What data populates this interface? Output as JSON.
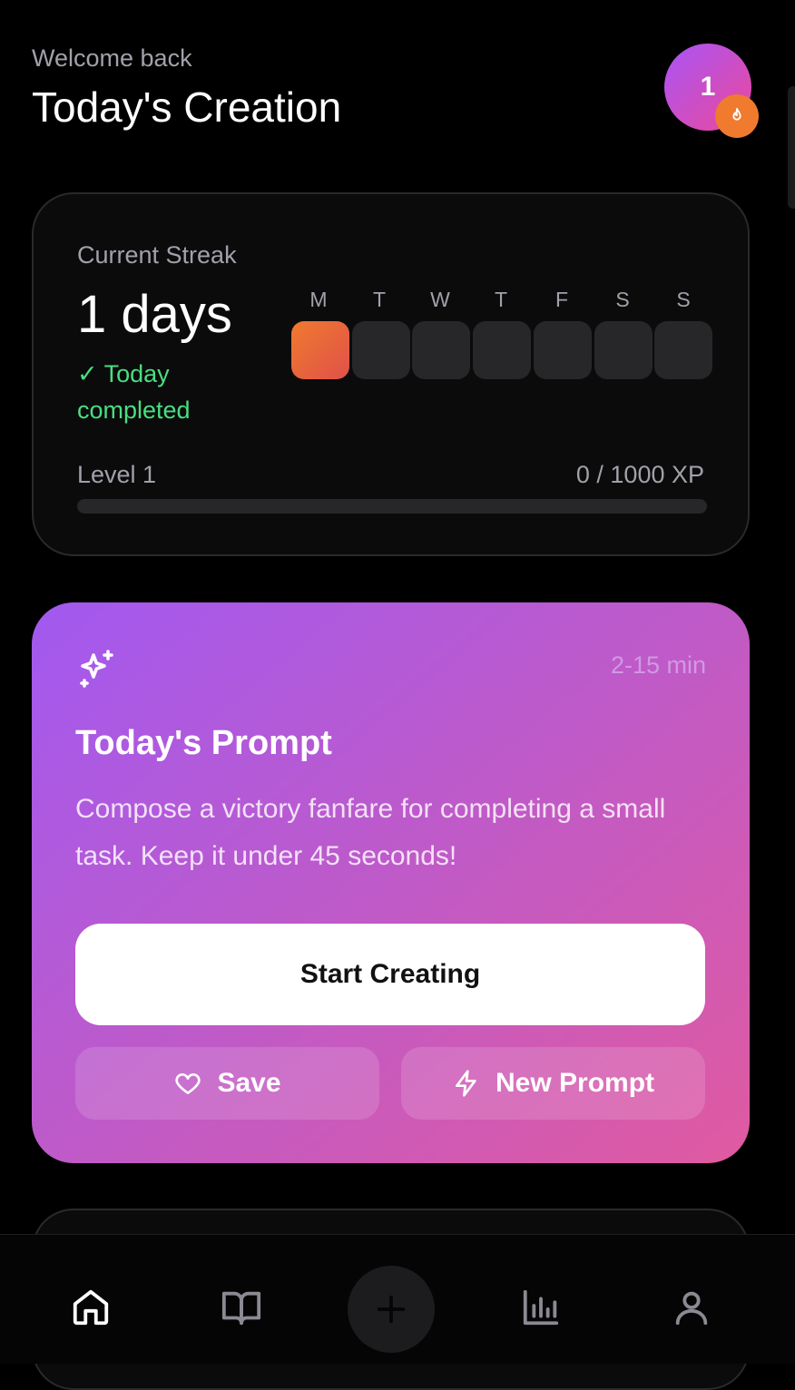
{
  "header": {
    "greeting": "Welcome back",
    "title": "Today's Creation",
    "avatar_level": "1",
    "streak_icon": "flame-icon"
  },
  "streak": {
    "label": "Current Streak",
    "value": "1 days",
    "status": "✓ Today completed",
    "week_days": [
      "M",
      "T",
      "W",
      "T",
      "F",
      "S",
      "S"
    ],
    "completed_days": [
      true,
      false,
      false,
      false,
      false,
      false,
      false
    ],
    "level": "Level 1",
    "xp": "0 / 1000 XP",
    "xp_progress": 0
  },
  "prompt": {
    "icon": "sparkles-icon",
    "duration": "2-15 min",
    "title": "Today's Prompt",
    "text": "Compose a victory fanfare for completing a small task. Keep it under 45 seconds!",
    "start_label": "Start Creating",
    "save_label": "Save",
    "new_prompt_label": "New Prompt"
  },
  "nav": {
    "items": [
      "home-icon",
      "book-icon",
      "plus-icon",
      "bar-chart-icon",
      "user-icon"
    ],
    "active": "home"
  },
  "colors": {
    "background": "#000000",
    "card": "#0b0b0c",
    "accent_green": "#4ade80",
    "flame_orange": "#f07a2e",
    "gradient_start": "#a259f0",
    "gradient_end": "#e05aa0"
  }
}
